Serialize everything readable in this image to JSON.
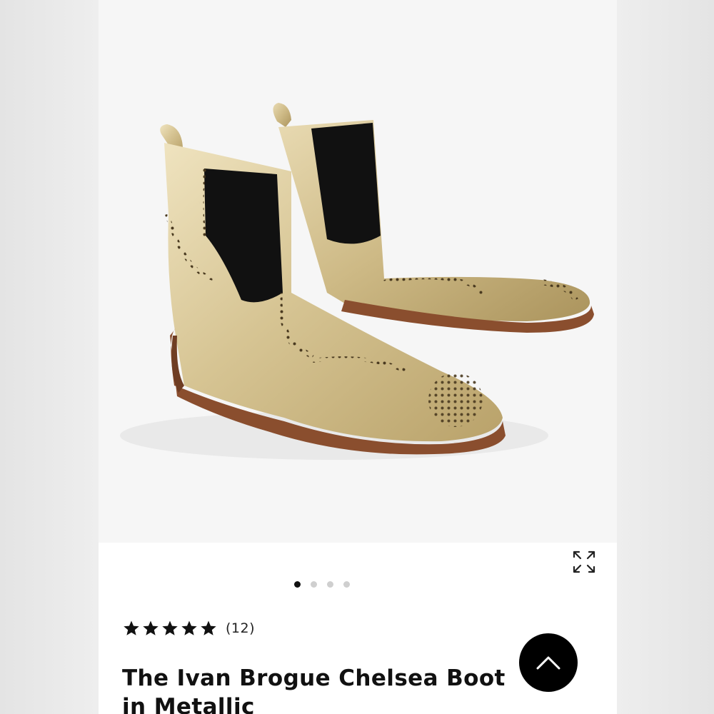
{
  "product": {
    "image_alt": "Gold metallic brogue chelsea boots",
    "rating": 5,
    "review_count": "(12)",
    "title": "The Ivan Brogue Chelsea Boot in Metallic"
  },
  "gallery": {
    "dots": 4,
    "active_index": 0
  },
  "icons": {
    "expand": "expand-icon",
    "star": "star-icon",
    "back_to_top": "chevron-up-icon"
  },
  "colors": {
    "accent": "#000000",
    "boot_gold": "#d8c79a",
    "sole_brown": "#8a4e2e"
  }
}
